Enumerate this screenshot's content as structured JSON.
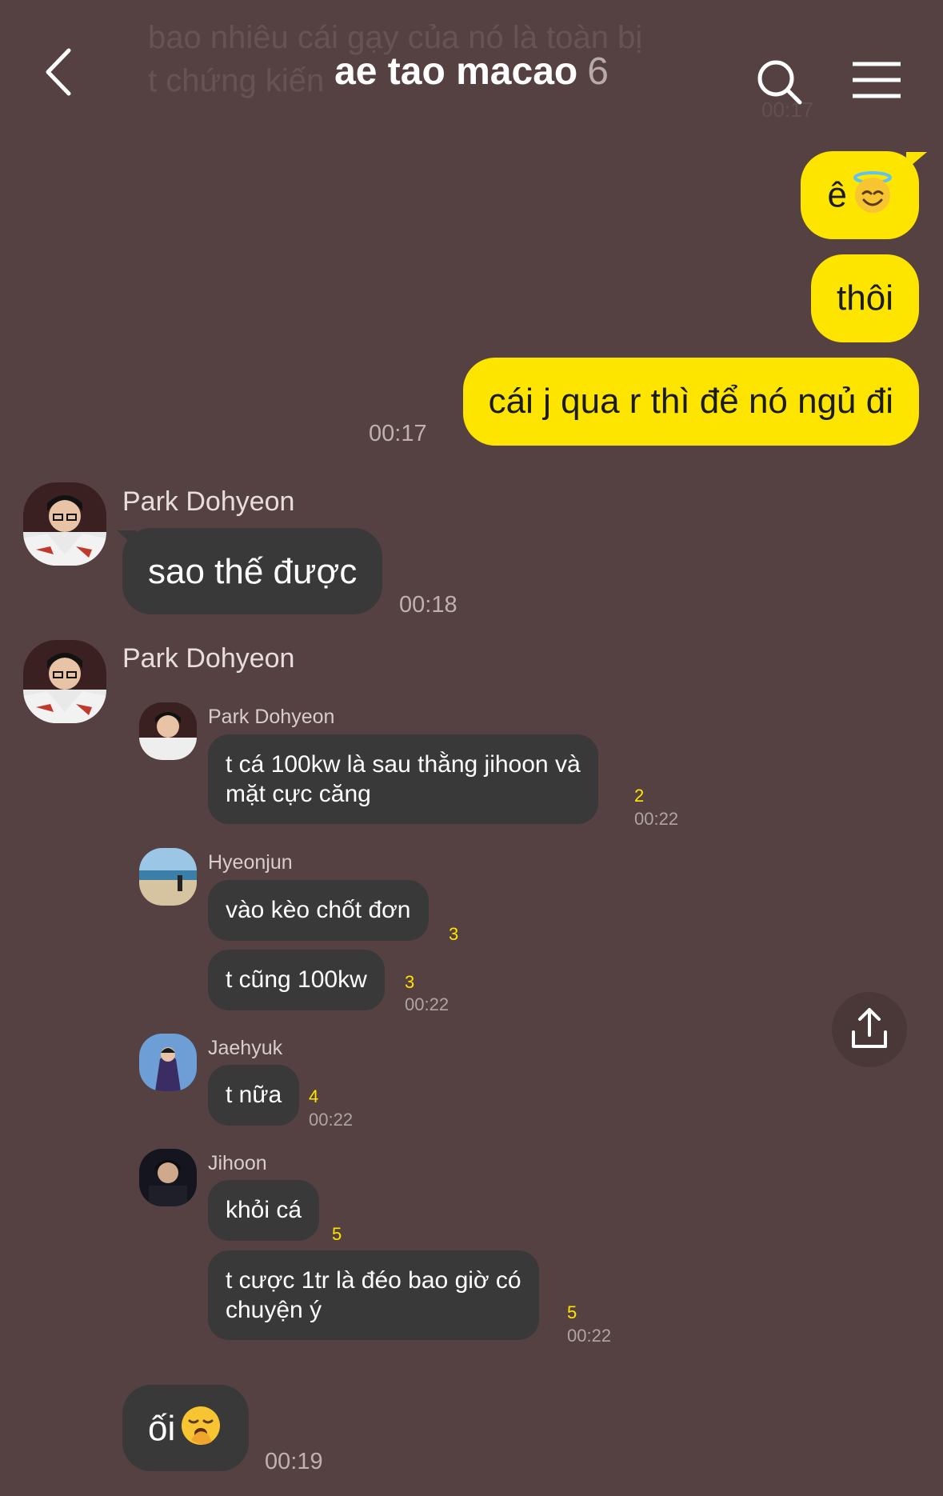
{
  "header": {
    "title": "ae tao macao",
    "member_count": "6",
    "ghost_line1": "bao nhiêu cái gạy của nó là toàn bị",
    "ghost_line2": "t chứng kiến",
    "ghost_time": "00:17"
  },
  "my_messages": [
    {
      "text": "ê",
      "emoji": "smiling-face-with-halo"
    },
    {
      "text": "thôi"
    },
    {
      "text": "cái j qua r thì để nó ngủ đi"
    }
  ],
  "my_time": "00:17",
  "msg1": {
    "sender": "Park Dohyeon",
    "text": "sao thế được",
    "time": "00:18"
  },
  "msg2": {
    "sender": "Park Dohyeon",
    "replies": [
      {
        "sender": "Park Dohyeon",
        "lines": [
          "t cá 100kw là sau thằng jihoon và",
          "mặt cực căng"
        ],
        "unread": "2",
        "time": "00:22"
      },
      {
        "sender": "Hyeonjun",
        "text": "vào kèo chốt đơn",
        "unread": "3"
      },
      {
        "text": "t cũng 100kw",
        "unread": "3",
        "time": "00:22"
      },
      {
        "sender": "Jaehyuk",
        "text": "t nữa",
        "unread": "4",
        "time": "00:22"
      },
      {
        "sender": "Jihoon",
        "text": "khỏi cá",
        "unread": "5"
      },
      {
        "lines": [
          "t cược 1tr là đéo bao giờ có",
          "chuyện ý"
        ],
        "unread": "5",
        "time": "00:22"
      }
    ]
  },
  "msg3": {
    "text": "ối",
    "emoji": "yawning-face",
    "time": "00:19"
  },
  "colors": {
    "background": "#554141",
    "my_bubble": "#fee500",
    "other_bubble": "#3a3939",
    "unread": "#fee500"
  }
}
